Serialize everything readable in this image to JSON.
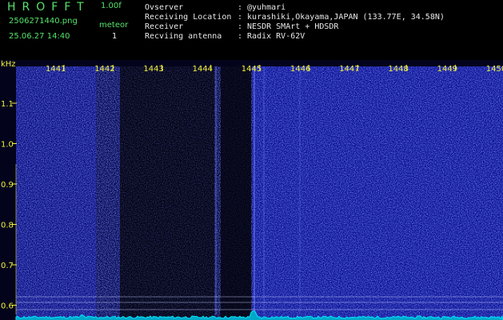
{
  "header": {
    "app_title": "HROFFT",
    "version": "1.00f",
    "filename": "2506271440.png",
    "datetime": "25.06.27 14:40",
    "mode_label": "meteor",
    "mode_value": "1"
  },
  "info": [
    {
      "label": "Ovserver",
      "value": ": @yuhmari"
    },
    {
      "label": "Receiving Location",
      "value": ": kurashiki,Okayama,JAPAN (133.77E, 34.58N)"
    },
    {
      "label": "Receiver",
      "value": ": NESDR SMArt + HDSDR"
    },
    {
      "label": "Recviing antenna",
      "value": ": Radix RV-62V"
    }
  ],
  "axes": {
    "y_unit": "kHz",
    "x_ticks": [
      "1441",
      "1442",
      "1443",
      "1444",
      "1445",
      "1446",
      "1447",
      "1448",
      "1449",
      "1450"
    ],
    "y_ticks": [
      "1.1",
      "1.0",
      "0.9",
      "0.8",
      "0.7",
      "0.6"
    ]
  },
  "colors": {
    "header_green": "#54e36a",
    "tick_yellow": "#f3f33a",
    "spectrum_cyan": "#00e5ff",
    "noise_blue": "#1f2bd9"
  }
}
